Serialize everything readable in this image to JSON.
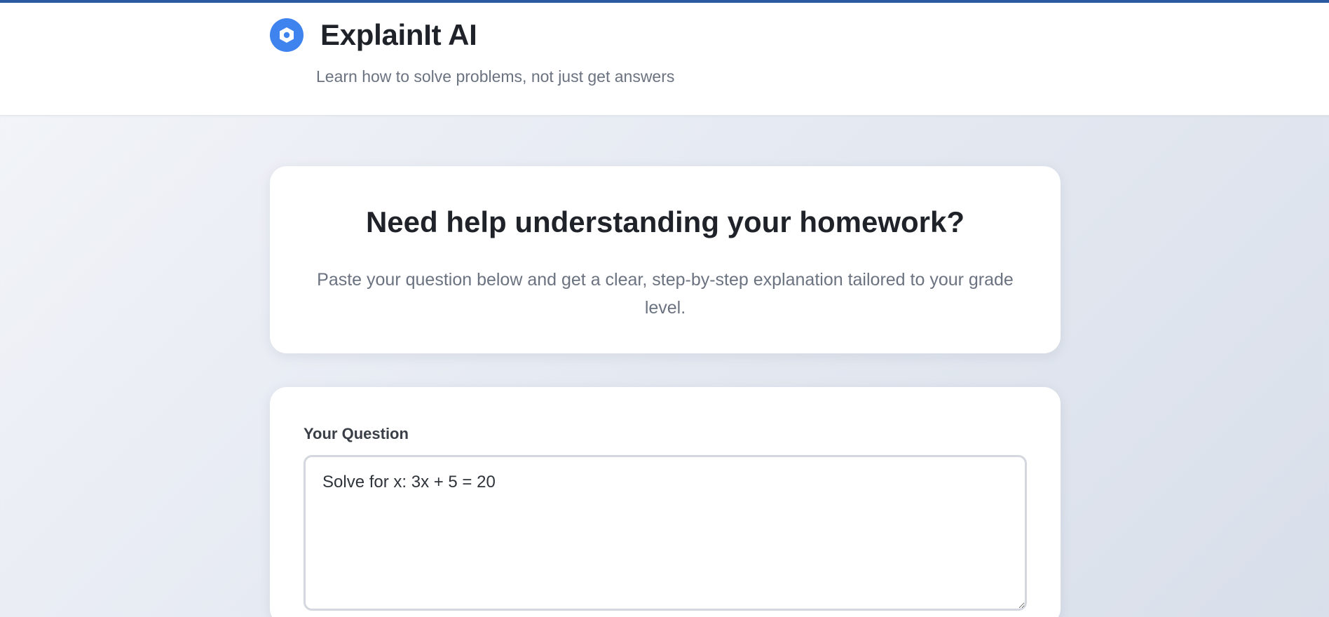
{
  "header": {
    "app_title": "ExplainIt AI",
    "tagline": "Learn how to solve problems, not just get answers",
    "logo_icon": "hexagon-nut-icon",
    "accent_color": "#3f83ef",
    "top_bar_color": "#2b5aa0"
  },
  "hero": {
    "heading": "Need help understanding your homework?",
    "description": "Paste your question below and get a clear, step-by-step explanation tailored to your grade level."
  },
  "form": {
    "question_label": "Your Question",
    "question_value": "Solve for x: 3x + 5 = 20"
  }
}
